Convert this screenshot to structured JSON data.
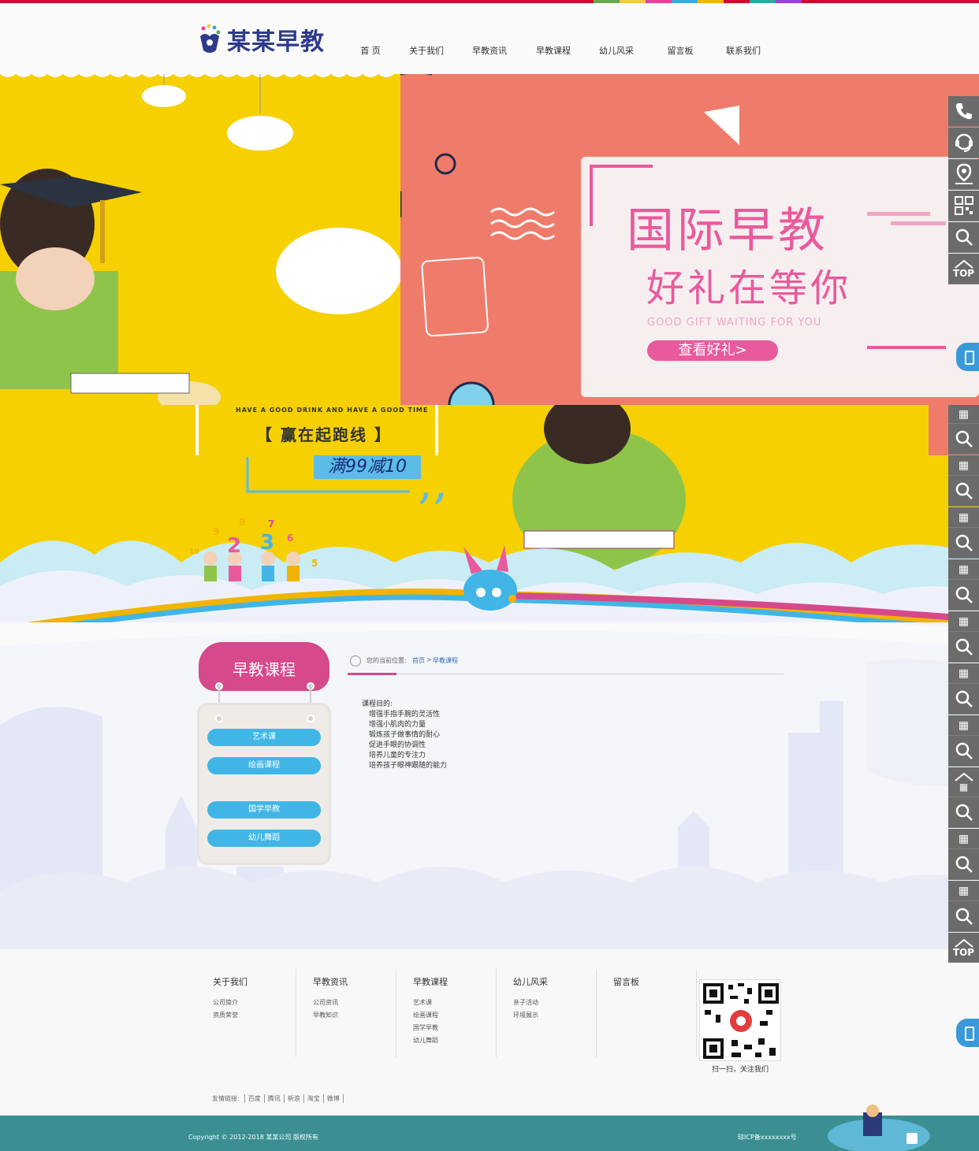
{
  "header": {
    "logo_text": "某某早教",
    "nav": [
      {
        "label": "首 页"
      },
      {
        "label": "关于我们"
      },
      {
        "label": "早教资讯"
      },
      {
        "label": "早教课程"
      },
      {
        "label": "幼儿风采"
      },
      {
        "label": "留言板"
      },
      {
        "label": "联系我们"
      }
    ]
  },
  "banner1": {
    "title": "国际早教",
    "subtitle": "好礼在等你",
    "english": "GOOD GIFT WAITING FOR YOU",
    "button": "查看好礼>"
  },
  "banner2": {
    "small": "HAVE A GOOD DRINK AND HAVE A GOOD TIME",
    "title": "【 赢在起跑线 】",
    "promo": "满99减10",
    "digits": [
      "9",
      "8",
      "7",
      "10",
      "2",
      "3",
      "6",
      "5"
    ]
  },
  "sidebar": {
    "title": "早教课程",
    "items": [
      {
        "label": "艺术课"
      },
      {
        "label": "绘画课程"
      },
      {
        "label": "国学早教"
      },
      {
        "label": "幼儿舞蹈"
      }
    ]
  },
  "breadcrumb": {
    "prefix": "您的当前位置:",
    "home": "首页",
    "sep": ">",
    "current": "早教课程"
  },
  "article": {
    "heading": "课程目的:",
    "lines": [
      "增强手指手腕的灵活性",
      "增强小肌肉的力量",
      "锻炼孩子做事情的耐心",
      "促进手眼的协调性",
      "培养儿童的专注力",
      "培养孩子眼神跟随的能力"
    ]
  },
  "footer": {
    "columns": [
      {
        "title": "关于我们",
        "items": [
          "公司简介",
          "资质荣誉"
        ]
      },
      {
        "title": "早教资讯",
        "items": [
          "公司资讯",
          "早教知识"
        ]
      },
      {
        "title": "早教课程",
        "items": [
          "艺术课",
          "绘画课程",
          "国学早教",
          "幼儿舞蹈"
        ]
      },
      {
        "title": "幼儿风采",
        "items": [
          "亲子活动",
          "环境展示"
        ]
      },
      {
        "title": "留言板",
        "items": []
      }
    ],
    "qr_caption": "扫一扫，关注我们",
    "friend_label": "友情链接:",
    "friend_links": [
      "百度",
      "腾讯",
      "新浪",
      "淘宝",
      "微博"
    ],
    "copyright": "Copyright © 2012-2018 某某公司 版权所有",
    "icp": "琼ICP备xxxxxxxx号"
  },
  "right_rail": {
    "icons": [
      "phone-icon",
      "customer-service-icon",
      "location-icon",
      "qr-icon",
      "search-icon",
      "top-icon"
    ],
    "top_label": "TOP"
  },
  "colors": {
    "brand_pink": "#d6498a",
    "brand_blue": "#41b6e6",
    "banner_yellow": "#f6d000",
    "banner_coral": "#ef7c6a",
    "footer_teal": "#3b8f93",
    "rail_gray": "#6b6b6b"
  }
}
